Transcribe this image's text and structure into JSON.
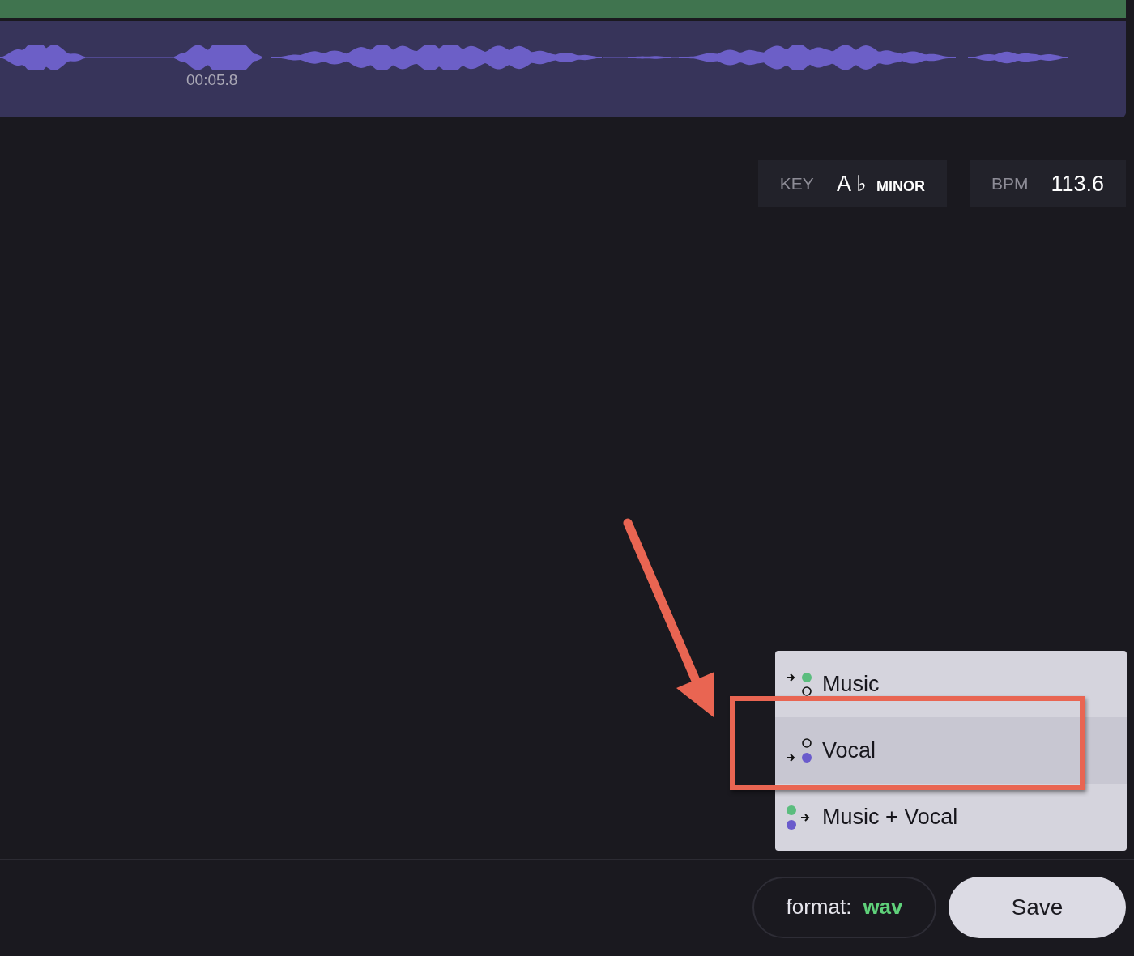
{
  "waveform": {
    "timestamp": "00:05.8"
  },
  "stats": [
    {
      "label": "KEY",
      "value": "A ♭",
      "suffix": "MINOR"
    },
    {
      "label": "BPM",
      "value": "113.6"
    }
  ],
  "menu": {
    "items": [
      {
        "label": "Music",
        "kind": "music",
        "selected": false
      },
      {
        "label": "Vocal",
        "kind": "vocal",
        "selected": true
      },
      {
        "label": "Music + Vocal",
        "kind": "mix",
        "selected": false
      }
    ]
  },
  "footer": {
    "format_label": "format:",
    "format_value": "wav",
    "save": "Save"
  }
}
